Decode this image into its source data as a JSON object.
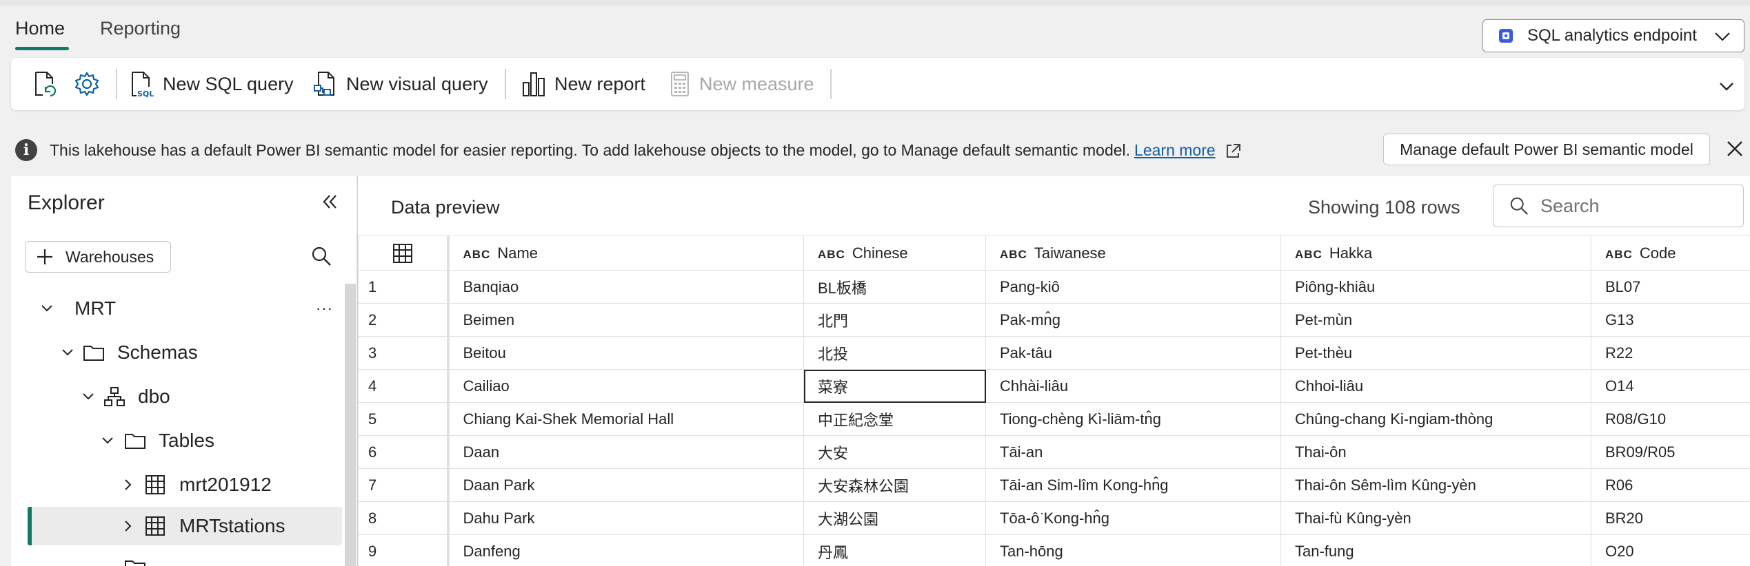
{
  "tabs": [
    {
      "label": "Home",
      "active": true
    },
    {
      "label": "Reporting",
      "active": false
    }
  ],
  "endpoint_selector": {
    "label": "SQL analytics endpoint"
  },
  "ribbon": {
    "new_sql_query": "New SQL query",
    "new_visual_query": "New visual query",
    "new_report": "New report",
    "new_measure": "New measure"
  },
  "infobar": {
    "message": "This lakehouse has a default Power BI semantic model for easier reporting. To add lakehouse objects to the model, go to Manage default semantic model.",
    "link": "Learn more",
    "manage_button": "Manage default Power BI semantic model"
  },
  "explorer": {
    "title": "Explorer",
    "warehouses_button": "Warehouses",
    "tree": [
      {
        "label": "MRT",
        "level": 0
      },
      {
        "label": "Schemas",
        "level": 1
      },
      {
        "label": "dbo",
        "level": 2
      },
      {
        "label": "Tables",
        "level": 3
      },
      {
        "label": "mrt201912",
        "level": 4
      },
      {
        "label": "MRTstations",
        "level": 4,
        "selected": true
      }
    ]
  },
  "preview": {
    "title": "Data preview",
    "row_count": "Showing 108 rows",
    "search_placeholder": "Search",
    "type_tag": "ABC",
    "columns": [
      "Name",
      "Chinese",
      "Taiwanese",
      "Hakka",
      "Code"
    ],
    "rows": [
      [
        "1",
        "Banqiao",
        "BL板橋",
        "Pang-kiô",
        "Piông-khiâu",
        "BL07"
      ],
      [
        "2",
        "Beimen",
        "北門",
        "Pak-mn̂g",
        "Pet-mùn",
        "G13"
      ],
      [
        "3",
        "Beitou",
        "北投",
        "Pak-tâu",
        "Pet-thèu",
        "R22"
      ],
      [
        "4",
        "Cailiao",
        "菜寮",
        "Chhài-liâu",
        "Chhoi-liâu",
        "O14"
      ],
      [
        "5",
        "Chiang Kai-Shek Memorial Hall",
        "中正紀念堂",
        "Tiong-chèng Kì-liām-tn̂g",
        "Chûng-chang Ki-ngiam-thòng",
        "R08/G10"
      ],
      [
        "6",
        "Daan",
        "大安",
        "Tāi-an",
        "Thai-ôn",
        "BR09/R05"
      ],
      [
        "7",
        "Daan Park",
        "大安森林公園",
        "Tāi-an Sim-lîm Kong-hn̂g",
        "Thai-ôn Sêm-lìm Kûng-yèn",
        "R06"
      ],
      [
        "8",
        "Dahu Park",
        "大湖公園",
        "Tōa-ô͘ Kong-hn̂g",
        "Thai-fù Kûng-yèn",
        "BR20"
      ],
      [
        "9",
        "Danfeng",
        "丹鳳",
        "Tan-hōng",
        "Tan-fung",
        "O20"
      ]
    ]
  }
}
